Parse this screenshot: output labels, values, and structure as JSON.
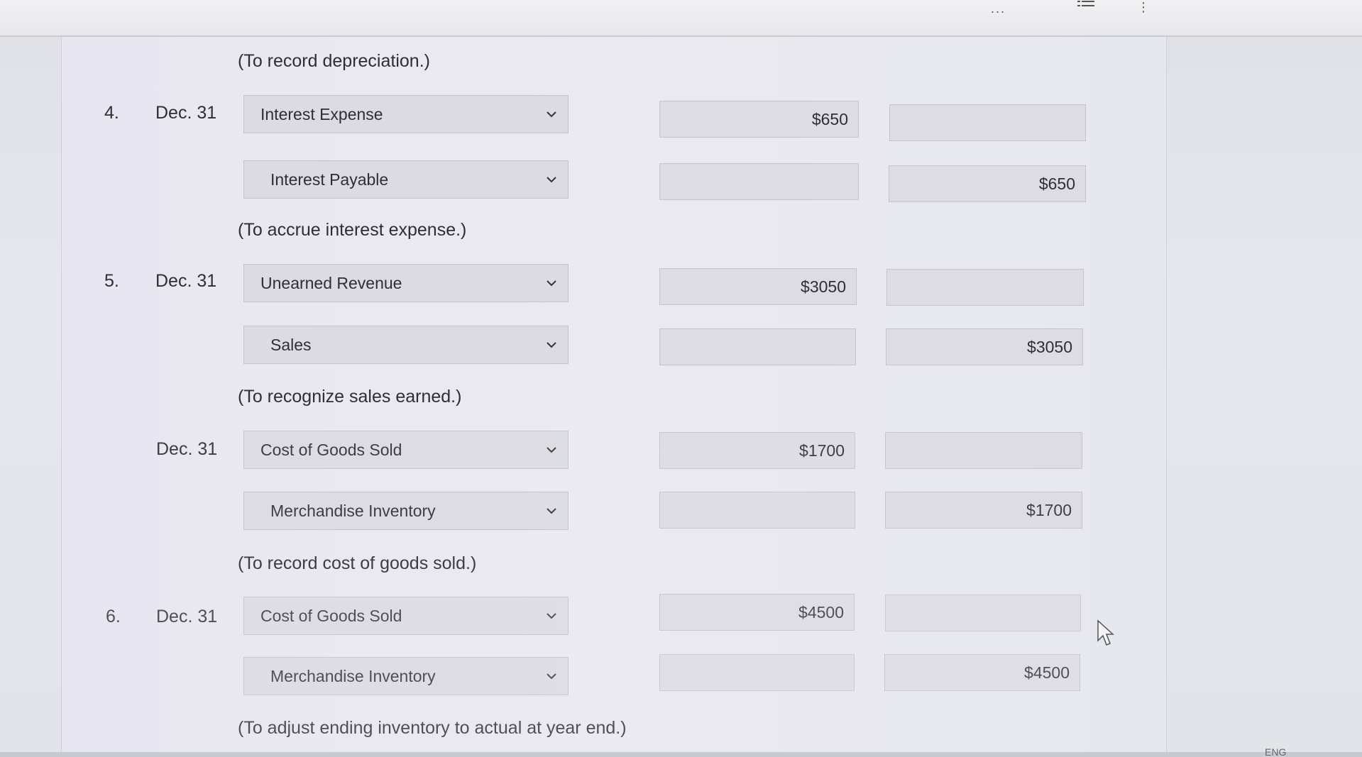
{
  "topbar": {
    "dots": "...",
    "list_icon": "list-icon",
    "kebab": "⋮"
  },
  "entries": [
    {
      "note_before": "(To record depreciation.)"
    },
    {
      "number": "4.",
      "date": "Dec. 31",
      "debit_account": "Interest Expense",
      "debit_amount": "$650",
      "credit_account": "Interest Payable",
      "credit_amount": "$650",
      "note": "(To accrue interest expense.)"
    },
    {
      "number": "5.",
      "date": "Dec. 31",
      "debit_account": "Unearned Revenue",
      "debit_amount": "$3050",
      "credit_account": "Sales",
      "credit_amount": "$3050",
      "note": "(To recognize sales earned.)"
    },
    {
      "number": "",
      "date": "Dec. 31",
      "debit_account": "Cost of Goods Sold",
      "debit_amount": "$1700",
      "credit_account": "Merchandise Inventory",
      "credit_amount": "$1700",
      "note": "(To record cost of goods sold.)"
    },
    {
      "number": "6.",
      "date": "Dec. 31",
      "debit_account": "Cost of Goods Sold",
      "debit_amount": "$4500",
      "credit_account": "Merchandise Inventory",
      "credit_amount": "$4500",
      "note": "(To adjust ending inventory to actual at year end.)"
    }
  ],
  "taskbar": {
    "language": "ENG"
  },
  "icons": {
    "dropdown": "chevron-down-icon",
    "pointer": "mouse-pointer-icon"
  }
}
